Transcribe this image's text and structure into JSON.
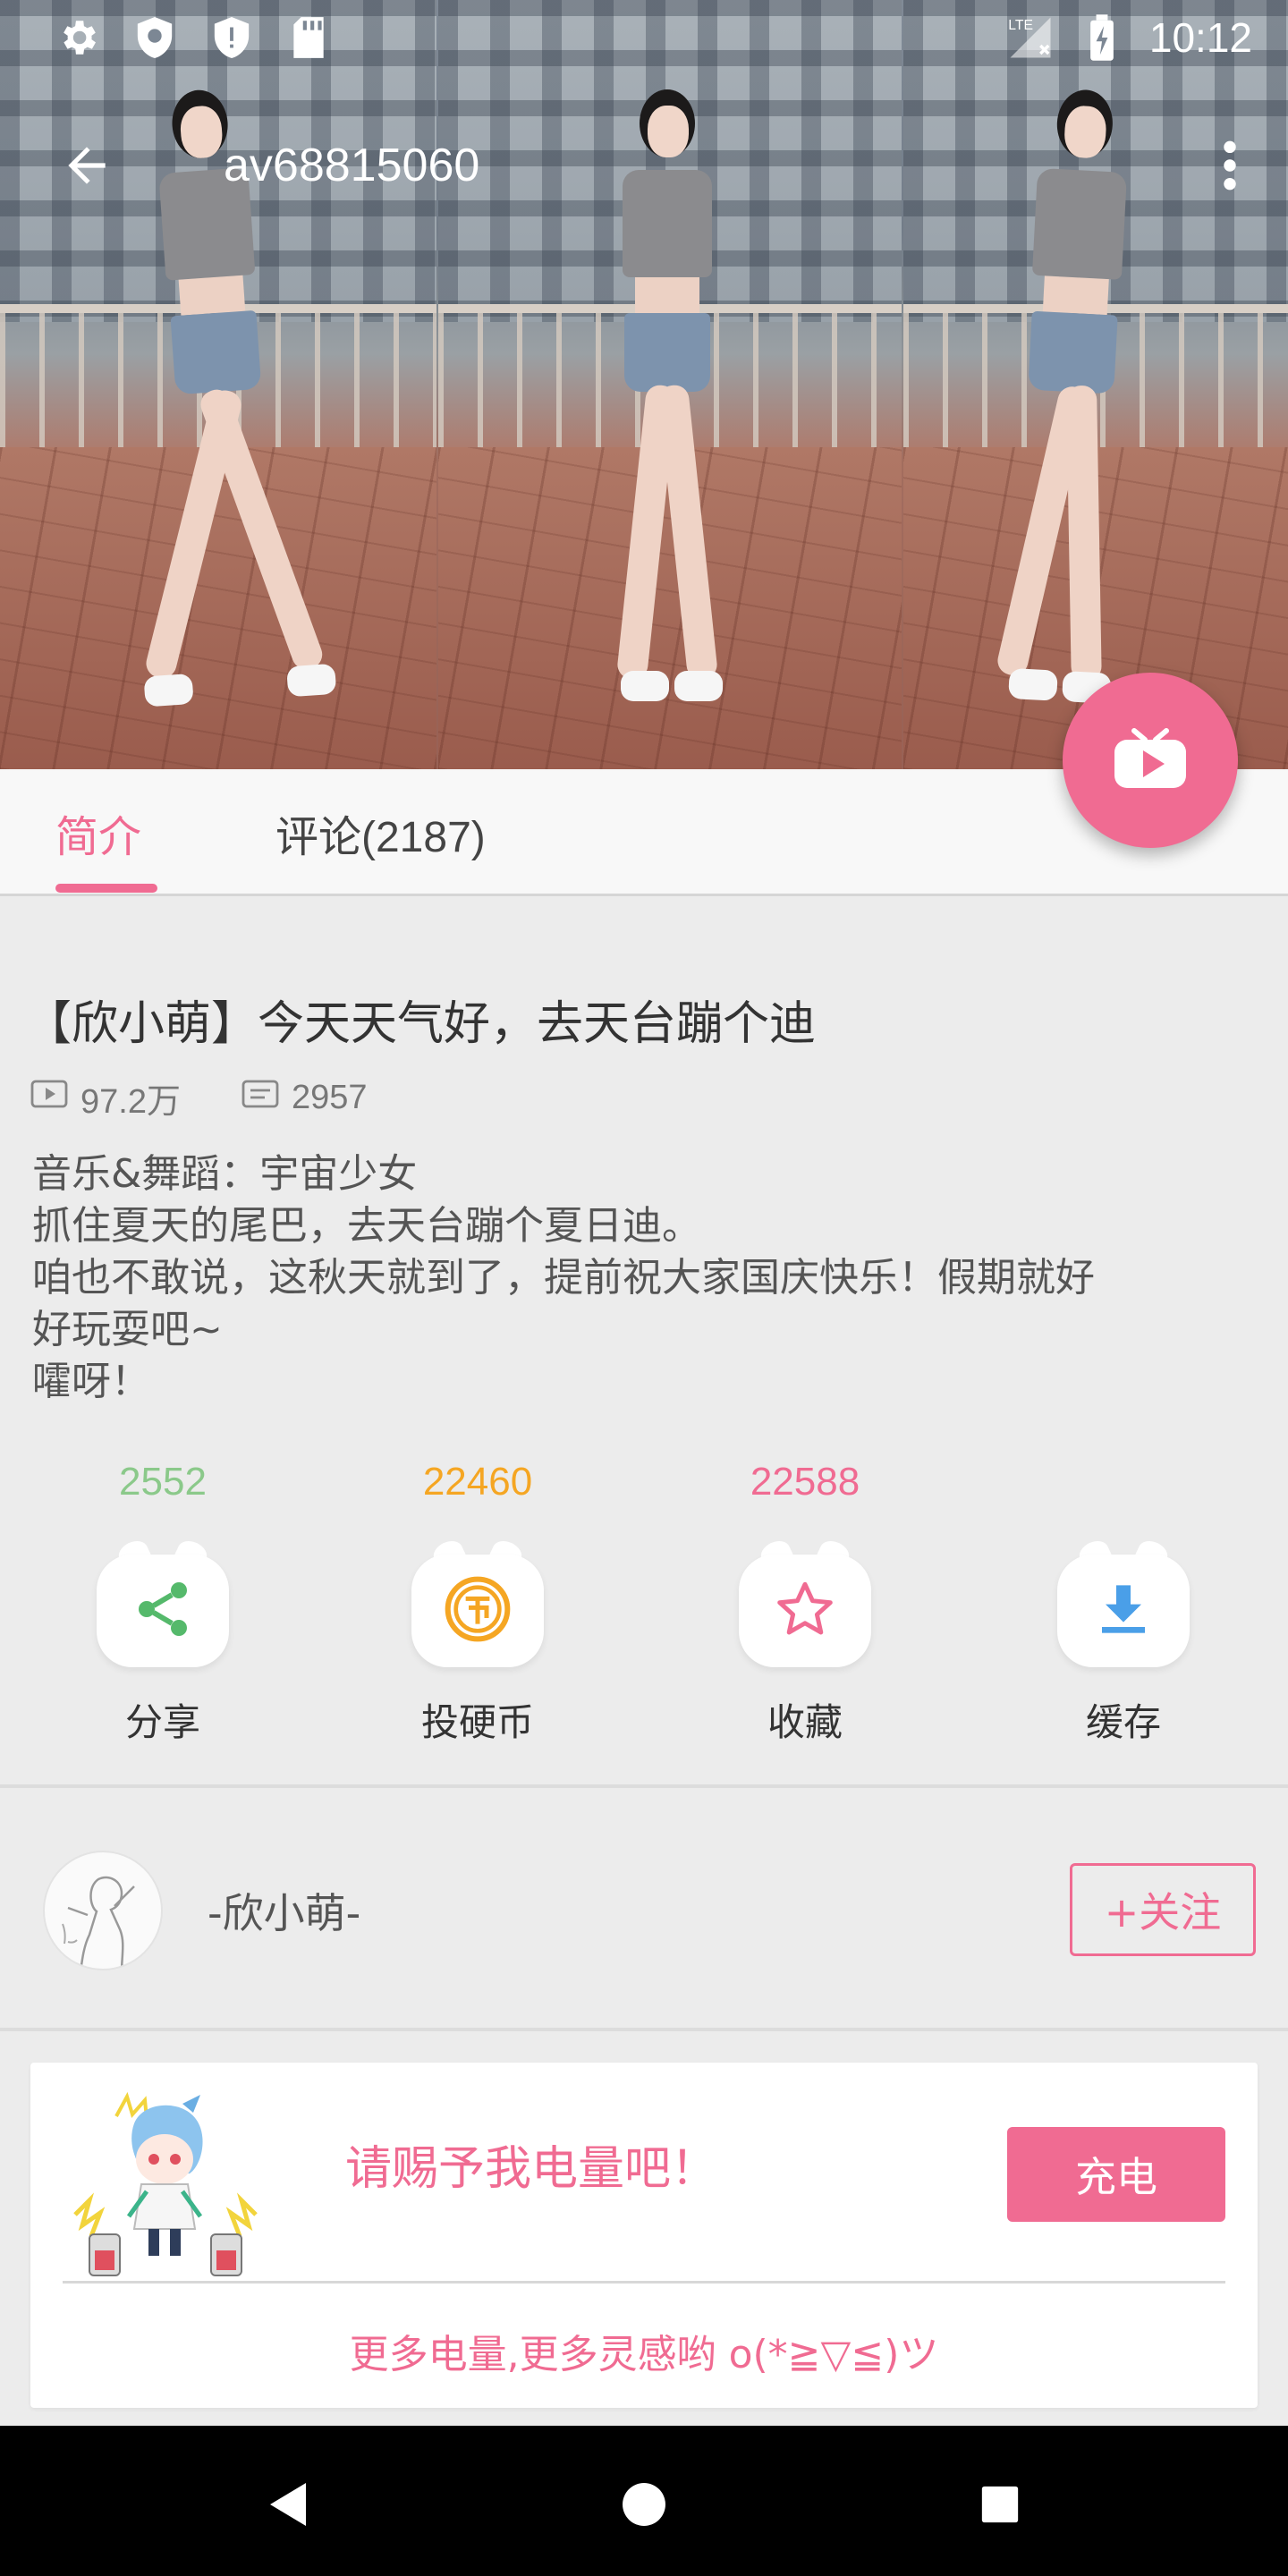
{
  "status_bar": {
    "time": "10:12",
    "network": "LTE",
    "left_icons": [
      "settings-icon",
      "shield-icon",
      "shield-alert-icon",
      "sd-card-icon"
    ],
    "right_icons": [
      "signal-icon",
      "battery-charging-icon"
    ]
  },
  "toolbar": {
    "title": "av68815060",
    "back_icon": "back-arrow-icon",
    "more_icon": "more-vert-icon"
  },
  "tabs": [
    {
      "label": "简介",
      "active": true
    },
    {
      "label": "评论(2187)",
      "active": false
    }
  ],
  "video": {
    "title": "【欣小萌】今天天气好，去天台蹦个迪",
    "views": "97.2万",
    "danmaku": "2957",
    "description_lines": [
      "音乐&舞蹈：宇宙少女",
      "抓住夏天的尾巴，去天台蹦个夏日迪。",
      "咱也不敢说，这秋天就到了，提前祝大家国庆快乐！假期就好",
      "好玩耍吧~",
      "嚯呀！"
    ]
  },
  "actions": [
    {
      "count": "2552",
      "label": "分享",
      "icon": "share-icon",
      "color": "#8bc98a"
    },
    {
      "count": "22460",
      "label": "投硬币",
      "icon": "coin-icon",
      "color": "#f5a623"
    },
    {
      "count": "22588",
      "label": "收藏",
      "icon": "star-icon",
      "color": "#f06b92"
    },
    {
      "count": "",
      "label": "缓存",
      "icon": "download-icon",
      "color": "#4a9fe8"
    }
  ],
  "uploader": {
    "name": "-欣小萌-",
    "follow_label": "+关注"
  },
  "charge": {
    "headline": "请赐予我电量吧！",
    "button_label": "充电",
    "tagline": "更多电量,更多灵感哟 o(*≧▽≦)ツ"
  },
  "colors": {
    "accent": "#f06b92",
    "background": "#ececec",
    "nav_bar": "#000000"
  }
}
